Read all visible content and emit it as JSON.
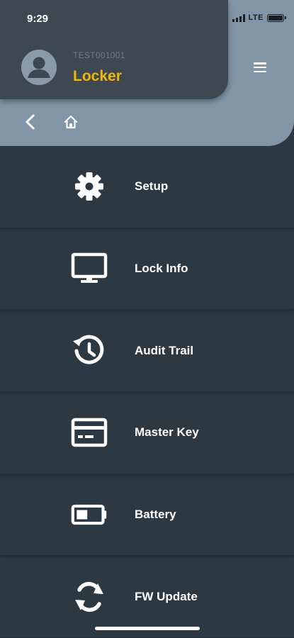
{
  "status_bar": {
    "time": "9:29",
    "network": "LTE"
  },
  "header": {
    "device_id": "TEST001001",
    "device_name": "Locker"
  },
  "nav": {
    "back_icon": "chevron-left-icon",
    "home_icon": "home-icon",
    "menu_icon": "hamburger-menu-icon"
  },
  "menu": {
    "items": [
      {
        "label": "Setup",
        "icon": "gear-icon"
      },
      {
        "label": "Lock Info",
        "icon": "monitor-icon"
      },
      {
        "label": "Audit Trail",
        "icon": "history-icon"
      },
      {
        "label": "Master Key",
        "icon": "card-icon"
      },
      {
        "label": "Battery",
        "icon": "battery-icon"
      },
      {
        "label": "FW Update",
        "icon": "sync-icon"
      }
    ]
  },
  "colors": {
    "background": "#2c3842",
    "header_card": "#3d4853",
    "nav_band": "#8195a6",
    "accent": "#f2b705"
  }
}
